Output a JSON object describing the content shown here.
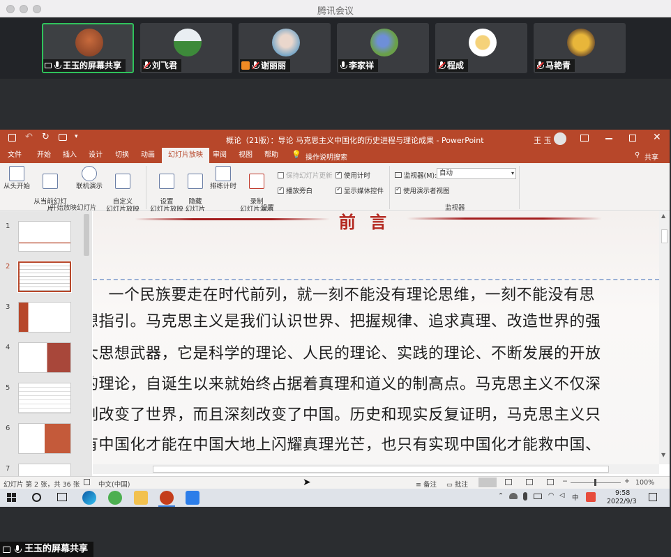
{
  "window": {
    "title": "腾讯会议"
  },
  "participants": [
    {
      "name": "王玉的屏幕共享",
      "active": true,
      "sharing": true,
      "muted": false
    },
    {
      "name": "刘飞君",
      "muted": true
    },
    {
      "name": "谢丽丽",
      "muted": true
    },
    {
      "name": "李家祥",
      "muted": false
    },
    {
      "name": "程成",
      "muted": true
    },
    {
      "name": "马艳青",
      "muted": true
    }
  ],
  "ppt": {
    "doc_title": "概论（21版）：导论 马克思主义中国化的历史进程与理论成果 - PowerPoint",
    "user": "王 玉",
    "tabs": [
      "文件",
      "开始",
      "插入",
      "设计",
      "切换",
      "动画",
      "幻灯片放映",
      "审阅",
      "视图",
      "帮助"
    ],
    "selected_tab": "幻灯片放映",
    "search_hint": "操作说明搜索",
    "share_label": "共享",
    "ribbon": {
      "group_start": {
        "label": "开始放映幻灯片",
        "buttons": [
          "从头开始",
          "从当前幻灯片\n开始",
          "联机演示",
          "自定义\n幻灯片放映"
        ]
      },
      "group_setup": {
        "label": "设置",
        "buttons": [
          "设置\n幻灯片放映",
          "隐藏\n幻灯片",
          "排练计时",
          "录制\n幻灯片演示"
        ],
        "checks": [
          {
            "label": "保持幻灯片更新",
            "on": false,
            "disabled": true
          },
          {
            "label": "使用计时",
            "on": true
          },
          {
            "label": "播放旁白",
            "on": true
          },
          {
            "label": "显示媒体控件",
            "on": true
          }
        ]
      },
      "group_monitor": {
        "label": "监视器",
        "monitor_label": "监视器(M):",
        "monitor_value": "自动",
        "presenter_view": "使用演示者视图"
      }
    },
    "thumb_numbers": [
      "1",
      "2",
      "3",
      "4",
      "5",
      "6",
      "7"
    ],
    "slide": {
      "heading": "前 言",
      "lines": [
        "　一个民族要走在时代前列，就一刻不能没有理论思维，一刻不能没有思",
        "想指引。马克思主义是我们认识世界、把握规律、追求真理、改造世界的强",
        "大思想武器，它是科学的理论、人民的理论、实践的理论、不断发展的开放",
        "的理论，自诞生以来就始终占据着真理和道义的制高点。马克思主义不仅深",
        "刻改变了世界，而且深刻改变了中国。历史和现实反复证明，马克思主义只",
        "有中国化才能在中国大地上闪耀真理光芒，也只有实现中国化才能救中国、"
      ]
    },
    "status": {
      "slide_info": "幻灯片 第 2 张，共 36 张",
      "language": "中文(中国)",
      "notes": "备注",
      "comments": "批注",
      "zoom": "100%"
    }
  },
  "taskbar": {
    "time": "9:58",
    "date": "2022/9/3",
    "ime": "中"
  },
  "bottom_share_tag": "王玉的屏幕共享",
  "colors": {
    "ppt_accent": "#b7472a",
    "active_border": "#2fc25b"
  }
}
